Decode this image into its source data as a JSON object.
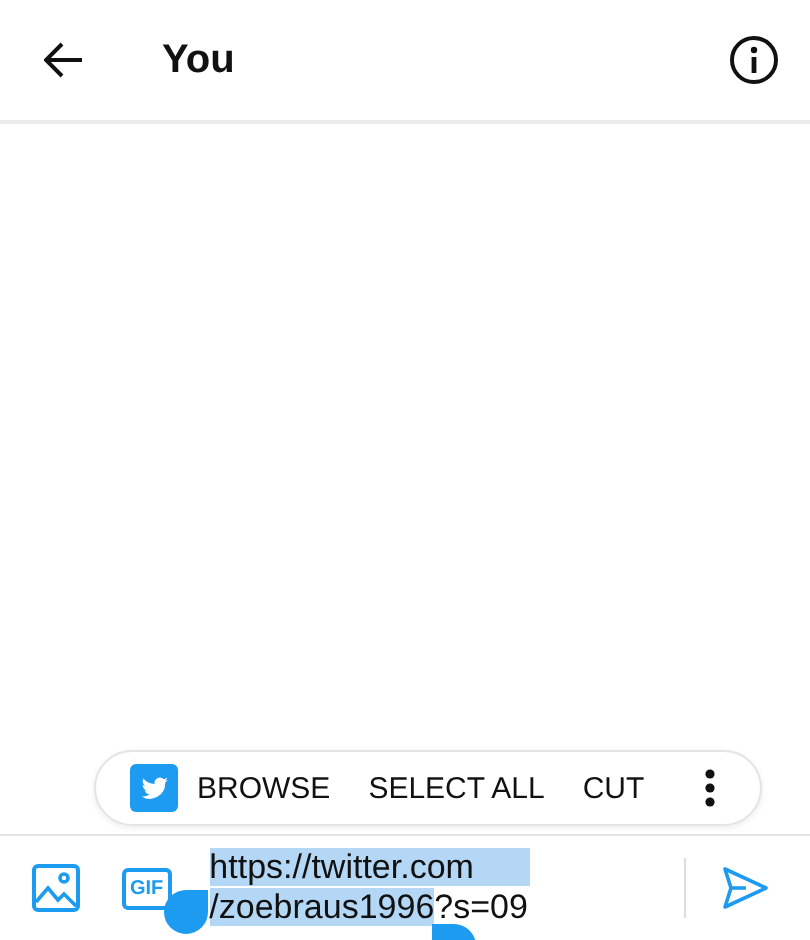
{
  "header": {
    "title": "You"
  },
  "context_menu": {
    "items": [
      {
        "label": "BROWSE"
      },
      {
        "label": "SELECT ALL"
      },
      {
        "label": "CUT"
      }
    ]
  },
  "composer": {
    "gif_label": "GIF",
    "lines": [
      [
        {
          "text": "https://twitter.com",
          "selected": true
        }
      ],
      [
        {
          "text": "/zoebraus1996",
          "selected": true
        },
        {
          "text": "?s=09",
          "selected": false
        }
      ]
    ]
  }
}
